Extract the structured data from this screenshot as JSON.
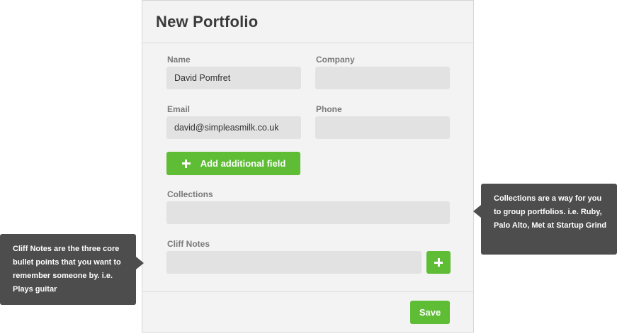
{
  "modal": {
    "title": "New Portfolio",
    "fields": {
      "name": {
        "label": "Name",
        "value": "David Pomfret"
      },
      "company": {
        "label": "Company",
        "value": ""
      },
      "email": {
        "label": "Email",
        "value": "david@simpleasmilk.co.uk"
      },
      "phone": {
        "label": "Phone",
        "value": ""
      },
      "collections": {
        "label": "Collections",
        "value": ""
      },
      "cliff_notes": {
        "label": "Cliff Notes",
        "value": ""
      }
    },
    "add_field_button": "Add additional field",
    "save_button": "Save"
  },
  "tooltips": {
    "collections": "Collections are a way for you to group portfolios.  i.e. Ruby, Palo Alto, Met at Startup Grind",
    "cliff_notes": "Cliff Notes are the three core bullet points that you want to remember someone by. i.e. Plays guitar"
  },
  "colors": {
    "accent_green": "#5ebd35",
    "tooltip_bg": "#4d4d4d",
    "panel_bg": "#f3f3f3",
    "field_bg": "#e2e2e2"
  },
  "icons": {
    "add_field": "plus-icon",
    "add_cliff_note": "plus-icon"
  }
}
